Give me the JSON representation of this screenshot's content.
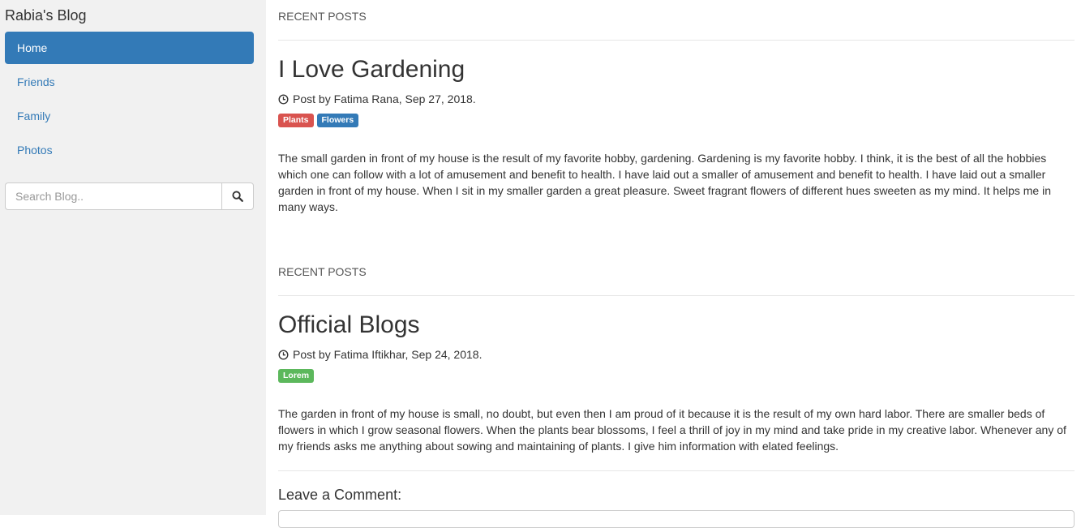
{
  "sidebar": {
    "blog_title": "Rabia's Blog",
    "nav": [
      {
        "label": "Home",
        "active": true
      },
      {
        "label": "Friends",
        "active": false
      },
      {
        "label": "Family",
        "active": false
      },
      {
        "label": "Photos",
        "active": false
      }
    ],
    "search": {
      "placeholder": "Search Blog..",
      "button_icon": "search-icon"
    }
  },
  "posts": [
    {
      "section_label": "RECENT POSTS",
      "title": "I Love Gardening",
      "meta": "Post by Fatima Rana, Sep 27, 2018.",
      "meta_icon": "clock-icon",
      "labels": [
        {
          "text": "Plants",
          "color": "#d9534f"
        },
        {
          "text": "Flowers",
          "color": "#337ab7"
        }
      ],
      "body": "The small garden in front of my house is the result of my favorite hobby, gardening. Gardening is my favorite hobby. I think, it is the best of all the hobbies which one can follow with a lot of amusement and benefit to health. I have laid out a smaller of amusement and benefit to health. I have laid out a smaller garden in front of my house. When I sit in my smaller garden a great pleasure. Sweet fragrant flowers of different hues sweeten as my mind. It helps me in many ways."
    },
    {
      "section_label": "RECENT POSTS",
      "title": "Official Blogs",
      "meta": "Post by Fatima Iftikhar, Sep 24, 2018.",
      "meta_icon": "clock-icon",
      "labels": [
        {
          "text": "Lorem",
          "color": "#5cb85c"
        }
      ],
      "body": "The garden in front of my house is small, no doubt, but even then I am proud of it because it is the result of my own hard labor. There are smaller beds of flowers in which I grow seasonal flowers. When the plants bear blossoms, I feel a thrill of joy in my mind and take pride in my creative labor. Whenever any of my friends asks me anything about sowing and maintaining of plants. I give him information with elated feelings."
    }
  ],
  "comment": {
    "heading": "Leave a Comment:"
  },
  "colors": {
    "sidebar_bg": "#f1f1f1",
    "accent": "#337ab7"
  }
}
